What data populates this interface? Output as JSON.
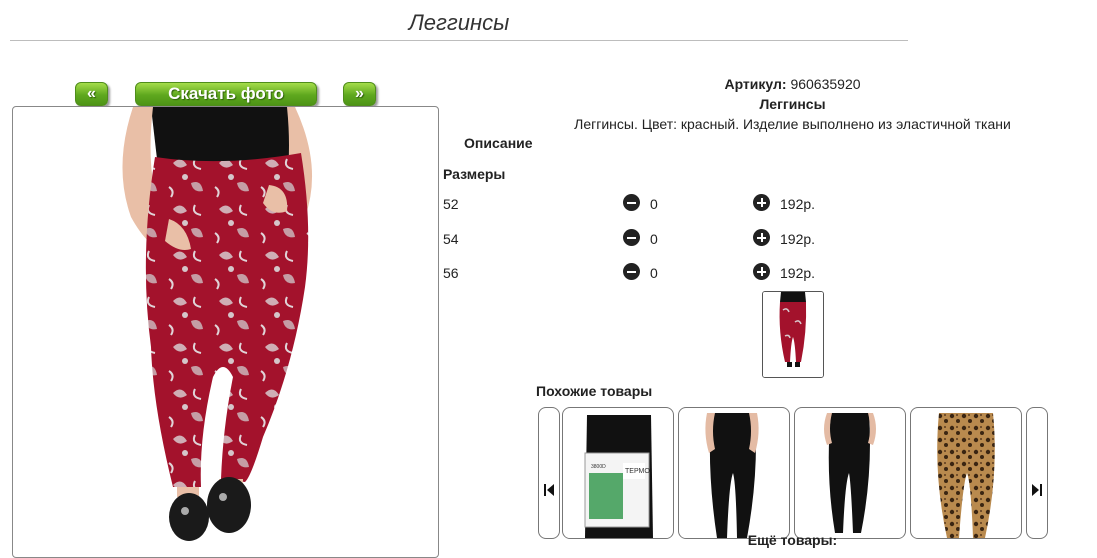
{
  "page": {
    "title": "Леггинсы"
  },
  "buttons": {
    "prev_label": "«",
    "download_label": "Скачать фото",
    "next_label": "»"
  },
  "product": {
    "article_label": "Артикул:",
    "article_value": "960635920",
    "name": "Леггинсы",
    "description_text": "Леггинсы. Цвет: красный. Изделие выполнено из эластичной ткани",
    "description_label": "Описание",
    "sizes_label": "Размеры",
    "sizes": [
      {
        "size": "52",
        "qty": "0",
        "price": "192р."
      },
      {
        "size": "54",
        "qty": "0",
        "price": "192р."
      },
      {
        "size": "56",
        "qty": "0",
        "price": "192р."
      }
    ]
  },
  "similar": {
    "label": "Похожие товары",
    "more_label": "Ещё товары:",
    "thumb_texts": [
      "ТЕРМО",
      "3800D"
    ]
  },
  "colors": {
    "button_green": "#5fa81e",
    "leggings_red": "#a3122c",
    "icon_dark": "#222222"
  }
}
